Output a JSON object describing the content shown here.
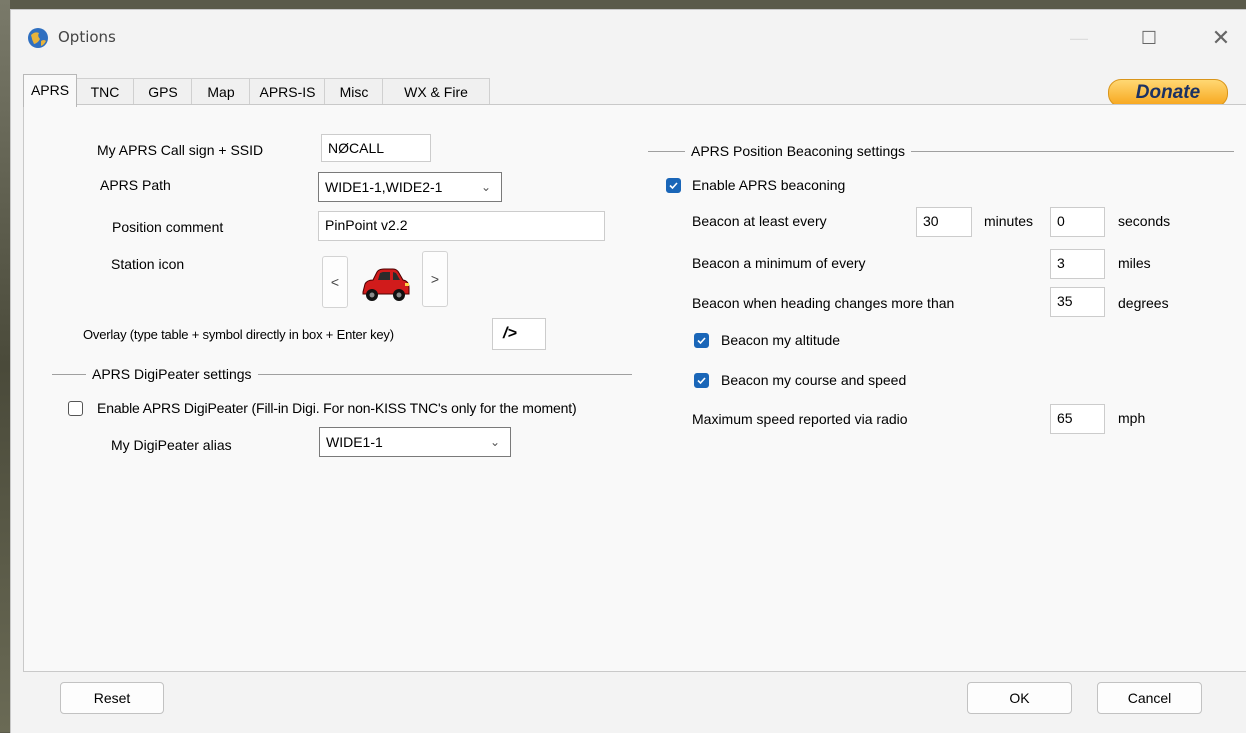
{
  "window": {
    "title": "Options",
    "minimize_icon": "minimize-icon",
    "maximize_icon": "maximize-icon",
    "close_icon": "close-icon"
  },
  "tabs": [
    {
      "label": "APRS",
      "active": true
    },
    {
      "label": "TNC"
    },
    {
      "label": "GPS"
    },
    {
      "label": "Map"
    },
    {
      "label": "APRS-IS"
    },
    {
      "label": "Misc"
    },
    {
      "label": "WX & Fire"
    }
  ],
  "donate_label": "Donate",
  "left": {
    "callsign_label": "My APRS Call sign + SSID",
    "callsign_value": "NØCALL",
    "path_label": "APRS Path",
    "path_value": "WIDE1-1,WIDE2-1",
    "comment_label": "Position comment",
    "comment_value": "PinPoint v2.2",
    "station_icon_label": "Station icon",
    "prev_symbol": "<",
    "next_symbol": ">",
    "station_icon": "car-icon",
    "overlay_label": "Overlay (type table + symbol directly in box + Enter key)",
    "overlay_value": "/>",
    "digi_section_title": "APRS DigiPeater settings",
    "enable_digi_label": "Enable APRS DigiPeater (Fill-in Digi. For non-KISS TNC's only for the moment)",
    "enable_digi_checked": false,
    "digi_alias_label": "My DigiPeater alias",
    "digi_alias_value": "WIDE1-1"
  },
  "right": {
    "section_title": "APRS Position Beaconing settings",
    "enable_beacon_label": "Enable APRS beaconing",
    "enable_beacon_checked": true,
    "every_label": "Beacon at least every",
    "every_minutes": "30",
    "minutes_unit": "minutes",
    "every_seconds": "0",
    "seconds_unit": "seconds",
    "min_label": "Beacon a minimum of every",
    "min_miles": "3",
    "miles_unit": "miles",
    "heading_label": "Beacon when heading changes more than",
    "heading_degrees": "35",
    "degrees_unit": "degrees",
    "altitude_label": "Beacon my altitude",
    "altitude_checked": true,
    "course_label": "Beacon my course and speed",
    "course_checked": true,
    "maxspeed_label": "Maximum speed reported via radio",
    "maxspeed_value": "65",
    "mph_unit": "mph"
  },
  "buttons": {
    "reset": "Reset",
    "ok": "OK",
    "cancel": "Cancel"
  },
  "colors": {
    "accent": "#1a66b8",
    "donate": "#f7a51c",
    "donate_text": "#1b3163",
    "car": "#d11b1b"
  }
}
